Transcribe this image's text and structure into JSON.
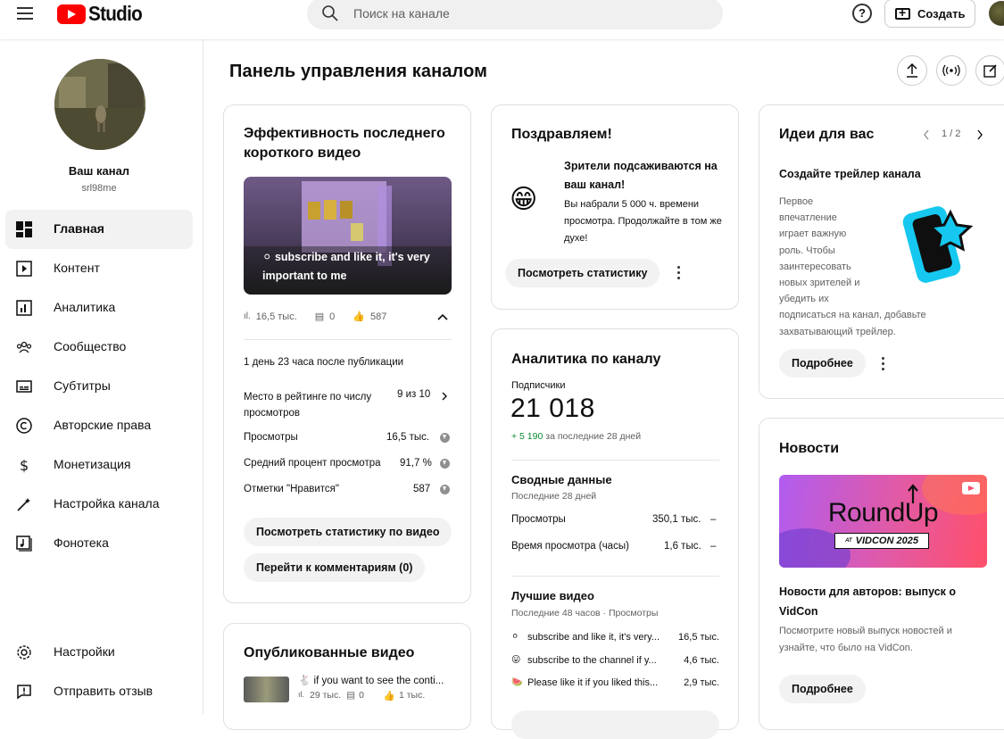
{
  "header": {
    "logo_text": "Studio",
    "search_placeholder": "Поиск на канале",
    "help_label": "?",
    "create_label": "Создать"
  },
  "sidebar": {
    "channel_name": "Ваш канал",
    "channel_handle": "srl98me",
    "items": [
      {
        "label": "Главная",
        "icon": "dashboard-icon"
      },
      {
        "label": "Контент",
        "icon": "content-icon"
      },
      {
        "label": "Аналитика",
        "icon": "analytics-icon"
      },
      {
        "label": "Сообщество",
        "icon": "community-icon"
      },
      {
        "label": "Субтитры",
        "icon": "subtitles-icon"
      },
      {
        "label": "Авторские права",
        "icon": "copyright-icon"
      },
      {
        "label": "Монетизация",
        "icon": "monetization-icon"
      },
      {
        "label": "Настройка канала",
        "icon": "customization-icon"
      },
      {
        "label": "Фонотека",
        "icon": "audio-library-icon"
      }
    ],
    "bottom_items": [
      {
        "label": "Настройки",
        "icon": "settings-icon"
      },
      {
        "label": "Отправить отзыв",
        "icon": "feedback-icon"
      }
    ]
  },
  "main": {
    "title": "Панель управления каналом"
  },
  "short_card": {
    "title": "Эффективность последнего короткого видео",
    "thumb_caption": "⚪ subscribe and like it, it's very important to me",
    "views": "16,5 тыс.",
    "comments": "0",
    "likes": "587",
    "since": "1 день 23 часа после публикации",
    "rows": [
      {
        "label": "Место в рейтинге по числу просмотров",
        "value": "9 из 10"
      },
      {
        "label": "Просмотры",
        "value": "16,5 тыс."
      },
      {
        "label": "Средний процент просмотра",
        "value": "91,7 %"
      },
      {
        "label": "Отметки \"Нравится\"",
        "value": "587"
      }
    ],
    "btn_stats": "Посмотреть статистику по видео",
    "btn_comments": "Перейти к комментариям (0)"
  },
  "published_card": {
    "title": "Опубликованные видео",
    "video_title": "🐇 if you want to see the conti...",
    "video_views": "29 тыс.",
    "video_comments": "0",
    "video_likes": "1 тыс."
  },
  "congrats_card": {
    "title": "Поздравляем!",
    "emoji": "😁",
    "headline": "Зрители подсаживаются на ваш канал!",
    "text": "Вы набрали 5 000 ч. времени просмотра. Продолжайте в том же духе!",
    "btn": "Посмотреть статистику"
  },
  "analytics_card": {
    "title": "Аналитика по каналу",
    "subs_label": "Подписчики",
    "subs_value": "21 018",
    "subs_delta": "+ 5 190",
    "subs_period": "за последние 28 дней",
    "summary_title": "Сводные данные",
    "summary_period": "Последние 28 дней",
    "summary_rows": [
      {
        "label": "Просмотры",
        "value": "350,1 тыс.",
        "trend": "–"
      },
      {
        "label": "Время просмотра (часы)",
        "value": "1,6 тыс.",
        "trend": "–"
      }
    ],
    "top_title": "Лучшие видео",
    "top_period": "Последние 48 часов · Просмотры",
    "top_videos": [
      {
        "emoji": "⚪",
        "title": "subscribe and like it, it's very...",
        "views": "16,5 тыс."
      },
      {
        "emoji": "😛",
        "title": "subscribe to the channel if y...",
        "views": "4,6 тыс."
      },
      {
        "emoji": "🍉",
        "title": "Please like it if you liked this...",
        "views": "2,9 тыс."
      }
    ]
  },
  "ideas_card": {
    "title": "Идеи для вас",
    "pager": "1 / 2",
    "subtitle": "Создайте трейлер канала",
    "text_lines": [
      "Первое",
      "впечатление",
      "играет важную",
      "роль. Чтобы",
      "заинтересовать",
      "новых зрителей и",
      "убедить их"
    ],
    "text_tail": "подписаться на канал, добавьте захватывающий трейлер.",
    "btn": "Подробнее"
  },
  "news_card": {
    "title": "Новости",
    "banner_title": "RoundUp",
    "banner_sub_at": "AT",
    "banner_sub": "VIDCON 2025",
    "headline": "Новости для авторов: выпуск о VidCon",
    "text": "Посмотрите новый выпуск новостей и узнайте, что было на VidCon.",
    "btn": "Подробнее"
  },
  "colors": {
    "brand_red": "#ff0000",
    "positive_green": "#0a8a2f",
    "news_gradient_start": "#b05cf0",
    "news_gradient_end": "#ff4f6a"
  }
}
